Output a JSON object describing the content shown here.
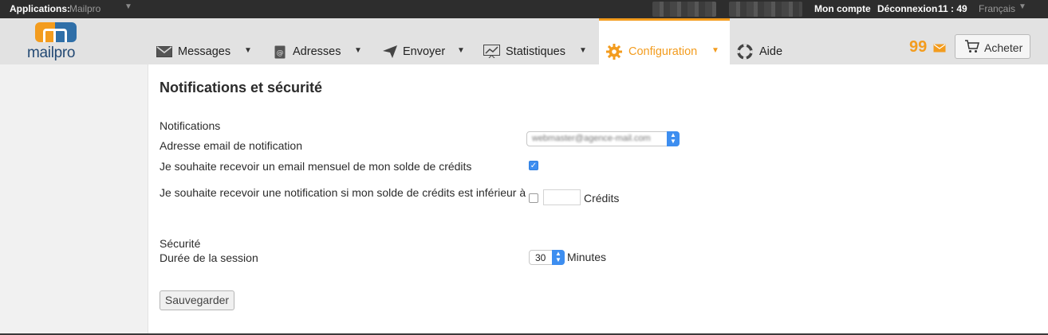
{
  "topbar": {
    "apps_label": "Applications:",
    "apps_value": "Mailpro",
    "account": "Mon compte",
    "logout": "Déconnexion",
    "clock": "11 : 49",
    "language": "Français"
  },
  "logo": {
    "text": "mailpro"
  },
  "nav": {
    "tabs": [
      {
        "label": "Messages",
        "icon": "envelope-icon"
      },
      {
        "label": "Adresses",
        "icon": "address-book-icon"
      },
      {
        "label": "Envoyer",
        "icon": "send-icon"
      },
      {
        "label": "Statistiques",
        "icon": "chart-icon"
      },
      {
        "label": "Configuration",
        "icon": "gear-icon",
        "active": true
      },
      {
        "label": "Aide",
        "icon": "lifebuoy-icon"
      }
    ],
    "credits": "99",
    "buy_label": "Acheter"
  },
  "page": {
    "title": "Notifications et sécurité",
    "notifications": {
      "title": "Notifications",
      "email_label": "Adresse email de notification",
      "email_value": "webmaster@agence-mail.com",
      "monthly_label": "Je souhaite recevoir un email mensuel de mon solde de crédits",
      "monthly_checked": true,
      "threshold_label": "Je souhaite recevoir une notification si mon solde de crédits est inférieur à",
      "threshold_checked": false,
      "threshold_value": "",
      "threshold_unit": "Crédits"
    },
    "security": {
      "title": "Sécurité",
      "session_label": "Durée de la session",
      "session_value": "30",
      "session_unit": "Minutes"
    },
    "save_label": "Sauvegarder"
  },
  "colors": {
    "accent": "#f39c1e",
    "brand_blue": "#2f6fa8",
    "topbar": "#2d2d2d",
    "navbar": "#e2e2e2",
    "checkbox_blue": "#3d8ef0"
  }
}
